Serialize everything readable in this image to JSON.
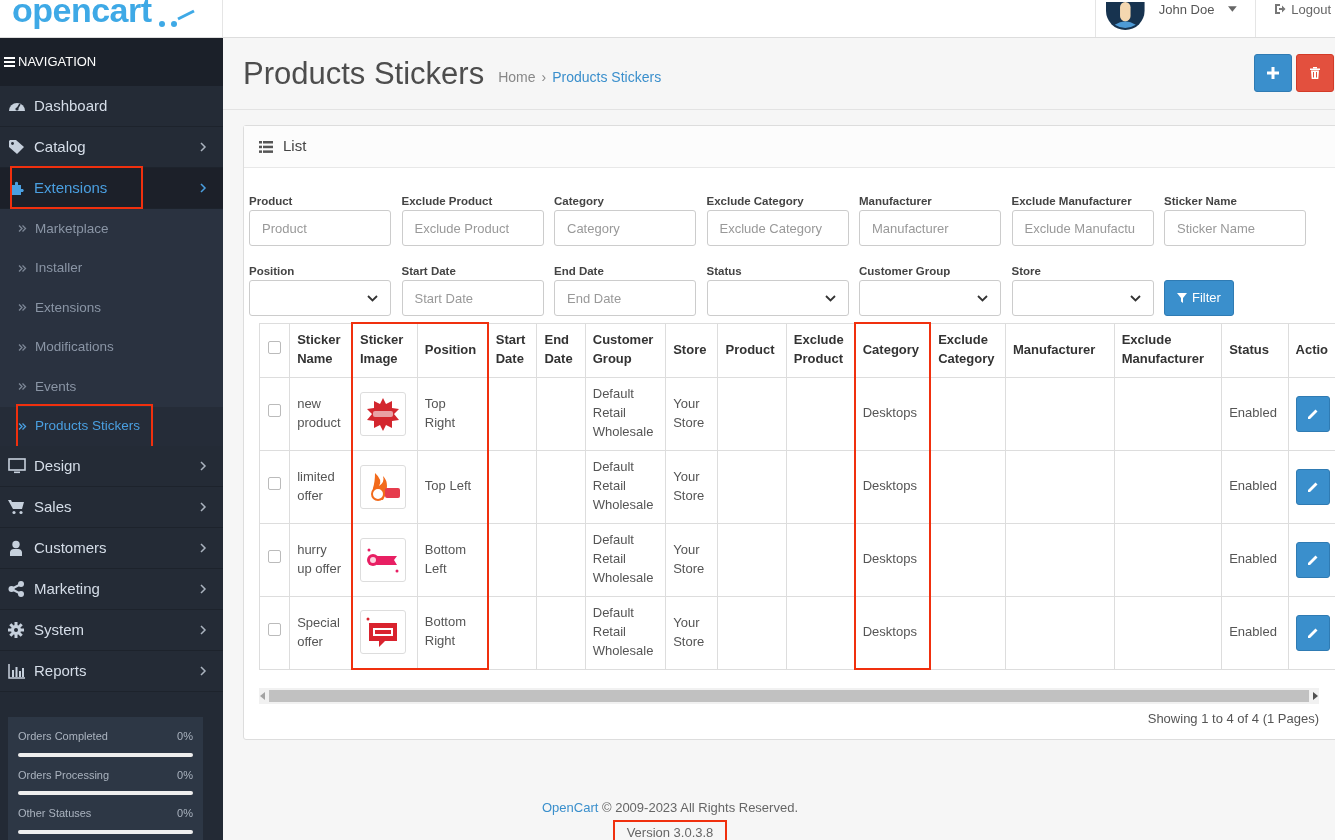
{
  "header": {
    "logo": "opencart",
    "user": "John Doe",
    "logout": "Logout"
  },
  "sidebar": {
    "title": "NAVIGATION",
    "items": [
      {
        "label": "Dashboard",
        "kind": "link",
        "selected": false,
        "highlighted": false
      },
      {
        "label": "Catalog",
        "kind": "menu",
        "selected": false,
        "highlighted": false
      },
      {
        "label": "Extensions",
        "kind": "menu",
        "selected": true,
        "highlighted": true,
        "children": [
          {
            "label": "Marketplace",
            "selected": false,
            "highlighted": false
          },
          {
            "label": "Installer",
            "selected": false,
            "highlighted": false
          },
          {
            "label": "Extensions",
            "selected": false,
            "highlighted": false
          },
          {
            "label": "Modifications",
            "selected": false,
            "highlighted": false
          },
          {
            "label": "Events",
            "selected": false,
            "highlighted": false
          },
          {
            "label": "Products Stickers",
            "selected": true,
            "highlighted": true
          }
        ]
      },
      {
        "label": "Design",
        "kind": "menu",
        "selected": false,
        "highlighted": false
      },
      {
        "label": "Sales",
        "kind": "menu",
        "selected": false,
        "highlighted": false
      },
      {
        "label": "Customers",
        "kind": "menu",
        "selected": false,
        "highlighted": false
      },
      {
        "label": "Marketing",
        "kind": "menu",
        "selected": false,
        "highlighted": false
      },
      {
        "label": "System",
        "kind": "menu",
        "selected": false,
        "highlighted": false
      },
      {
        "label": "Reports",
        "kind": "menu",
        "selected": false,
        "highlighted": false
      }
    ],
    "stats": [
      {
        "label": "Orders Completed",
        "value": "0%",
        "level": 0
      },
      {
        "label": "Orders Processing",
        "value": "0%",
        "level": 0
      },
      {
        "label": "Other Statuses",
        "value": "0%",
        "level": 0
      }
    ]
  },
  "page": {
    "title": "Products Stickers",
    "breadcrumb": [
      {
        "label": "Home",
        "current": false
      },
      {
        "label": "Products Stickers",
        "current": true
      }
    ],
    "separator": "›"
  },
  "panel": {
    "title": "List",
    "filters": [
      {
        "label": "Product",
        "kind": "text",
        "placeholder": "Product"
      },
      {
        "label": "Exclude Product",
        "kind": "text",
        "placeholder": "Exclude Product"
      },
      {
        "label": "Category",
        "kind": "text",
        "placeholder": "Category"
      },
      {
        "label": "Exclude Category",
        "kind": "text",
        "placeholder": "Exclude Category"
      },
      {
        "label": "Manufacturer",
        "kind": "text",
        "placeholder": "Manufacturer"
      },
      {
        "label": "Exclude Manufacturer",
        "kind": "text",
        "placeholder": "Exclude Manufactu"
      },
      {
        "label": "Sticker Name",
        "kind": "text",
        "placeholder": "Sticker Name"
      },
      {
        "label": "Position",
        "kind": "select"
      },
      {
        "label": "Start Date",
        "kind": "text",
        "placeholder": "Start Date"
      },
      {
        "label": "End Date",
        "kind": "text",
        "placeholder": "End Date"
      },
      {
        "label": "Status",
        "kind": "select"
      },
      {
        "label": "Customer Group",
        "kind": "select"
      },
      {
        "label": "Store",
        "kind": "select"
      },
      {
        "label": "Filter",
        "kind": "button"
      }
    ],
    "table": {
      "select_all": {
        "checked": false
      },
      "columns": [
        {
          "label": "Sticker Name",
          "highlighted": false
        },
        {
          "label": "Sticker Image",
          "highlighted": true
        },
        {
          "label": "Position",
          "highlighted": true
        },
        {
          "label": "Start Date",
          "highlighted": false
        },
        {
          "label": "End Date",
          "highlighted": false
        },
        {
          "label": "Customer Group",
          "highlighted": false
        },
        {
          "label": "Store",
          "highlighted": false
        },
        {
          "label": "Product",
          "highlighted": false
        },
        {
          "label": "Exclude Product",
          "highlighted": false
        },
        {
          "label": "Category",
          "highlighted": true
        },
        {
          "label": "Exclude Category",
          "highlighted": false
        },
        {
          "label": "Manufacturer",
          "highlighted": false
        },
        {
          "label": "Exclude Manufacturer",
          "highlighted": false
        },
        {
          "label": "Status",
          "highlighted": false
        },
        {
          "label": "Actio",
          "highlighted": false
        }
      ],
      "rows": [
        {
          "checked": false,
          "cells": [
            "new product",
            null,
            "Top Right",
            "",
            "",
            "Default Retail Wholesale",
            "Your Store",
            "",
            "",
            "Desktops",
            "",
            "",
            "",
            "Enabled",
            null
          ]
        },
        {
          "checked": false,
          "cells": [
            "limited offer",
            null,
            "Top Left",
            "",
            "",
            "Default Retail Wholesale",
            "Your Store",
            "",
            "",
            "Desktops",
            "",
            "",
            "",
            "Enabled",
            null
          ]
        },
        {
          "checked": false,
          "cells": [
            "hurry up offer",
            null,
            "Bottom Left",
            "",
            "",
            "Default Retail Wholesale",
            "Your Store",
            "",
            "",
            "Desktops",
            "",
            "",
            "",
            "Enabled",
            null
          ]
        },
        {
          "checked": false,
          "cells": [
            "Special offer",
            null,
            "Bottom Right",
            "",
            "",
            "Default Retail Wholesale",
            "Your Store",
            "",
            "",
            "Desktops",
            "",
            "",
            "",
            "Enabled",
            null
          ]
        }
      ]
    },
    "pagination_text": "Showing 1 to 4 of 4 (1 Pages)"
  },
  "footer": {
    "link": "OpenCart",
    "text": "© 2009-2023 All Rights Reserved.",
    "version": "Version 3.0.3.8",
    "version_highlighted": true
  }
}
